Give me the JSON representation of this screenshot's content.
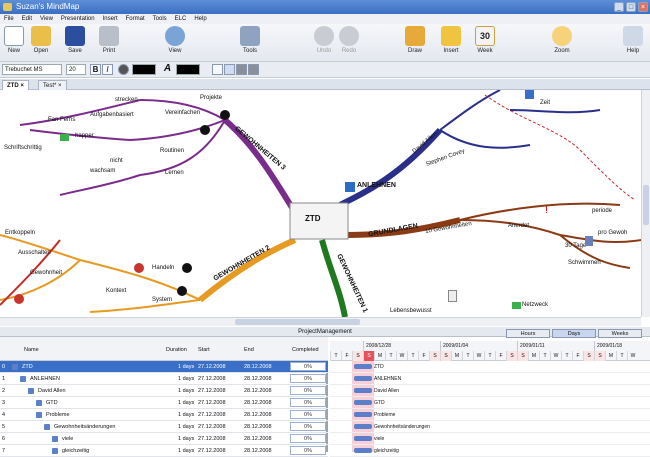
{
  "window": {
    "title": "Suzan's MindMap"
  },
  "menu": [
    "File",
    "Edit",
    "View",
    "Presentation",
    "Insert",
    "Format",
    "Tools",
    "ELC",
    "Help"
  ],
  "toolbar": {
    "new": "New",
    "open": "Open",
    "save": "Save",
    "print": "Print",
    "view": "View",
    "tools": "Tools",
    "undo": "Undo",
    "redo": "Redo",
    "draw": "Draw",
    "insert": "Insert",
    "week": "Week",
    "zoom": "Zoom",
    "help": "Help",
    "week_day": "30"
  },
  "format": {
    "font": "Trebuchet MS",
    "size": "20",
    "bold": "B",
    "italic": "I",
    "text": "A"
  },
  "tabs": [
    "ZTD",
    "Test*"
  ],
  "mindmap": {
    "center": "ZTD",
    "branches": [
      "GEWOHNHEITEN 3",
      "ANLEHNEN",
      "GRUNDLAGEN",
      "GEWOHNHEITEN 1",
      "GEWOHNHEITEN 2"
    ],
    "labels": [
      "Fan Ferris",
      "Aufgabenbasiert",
      "Schriftschrittig",
      "strecken",
      "Vereinfachen",
      "Projekte",
      "happer",
      "Routinen",
      "wachsam",
      "nicht",
      "Lernen",
      "David Allen",
      "Stephen Covey",
      "Zeit",
      "10 Gewohnheiten",
      "Anerdet",
      "30 Tage",
      "pro Gewoh",
      "Schwimmen",
      "periode",
      "Handeln",
      "System",
      "Kontext",
      "Ausschalten",
      "Netzweck",
      "Lebensbewusst",
      "Entkoppeln",
      "Gewohnheit"
    ]
  },
  "pm": {
    "title": "ProjectManagement",
    "columns": [
      "Name",
      "Duration",
      "Start",
      "End",
      "Completed"
    ],
    "buttons": [
      "Hours",
      "Days",
      "Weeks"
    ],
    "weeks": [
      "2008/12/28",
      "2009/01/04",
      "2009/01/11",
      "2009/01/18"
    ],
    "days": [
      "T",
      "F",
      "S",
      "S",
      "M",
      "T",
      "W",
      "T",
      "F",
      "S",
      "S",
      "M",
      "T",
      "W",
      "T",
      "F",
      "S",
      "S",
      "M",
      "T",
      "W",
      "T",
      "F",
      "S",
      "S",
      "M",
      "T",
      "W"
    ],
    "rows": [
      {
        "n": "0",
        "name": "ZTD",
        "dur": "1 days",
        "start": "27.12.2008",
        "end": "28.12.2008",
        "pct": "0%",
        "indent": 0
      },
      {
        "n": "1",
        "name": "ANLEHNEN",
        "dur": "1 days",
        "start": "27.12.2008",
        "end": "28.12.2008",
        "pct": "0%",
        "indent": 1
      },
      {
        "n": "2",
        "name": "David Allen",
        "dur": "1 days",
        "start": "27.12.2008",
        "end": "28.12.2008",
        "pct": "0%",
        "indent": 2
      },
      {
        "n": "3",
        "name": "GTD",
        "dur": "1 days",
        "start": "27.12.2008",
        "end": "28.12.2008",
        "pct": "0%",
        "indent": 3
      },
      {
        "n": "4",
        "name": "Probleme",
        "dur": "1 days",
        "start": "27.12.2008",
        "end": "28.12.2008",
        "pct": "0%",
        "indent": 3
      },
      {
        "n": "5",
        "name": "Gewohnheitsänderungen",
        "dur": "1 days",
        "start": "27.12.2008",
        "end": "28.12.2008",
        "pct": "0%",
        "indent": 4
      },
      {
        "n": "6",
        "name": "viele",
        "dur": "1 days",
        "start": "27.12.2008",
        "end": "28.12.2008",
        "pct": "0%",
        "indent": 5
      },
      {
        "n": "7",
        "name": "gleichzeitig",
        "dur": "1 days",
        "start": "27.12.2008",
        "end": "28.12.2008",
        "pct": "0%",
        "indent": 5
      }
    ]
  },
  "colors": {
    "accent": "#3a6fc8",
    "today": "#e3545a"
  }
}
